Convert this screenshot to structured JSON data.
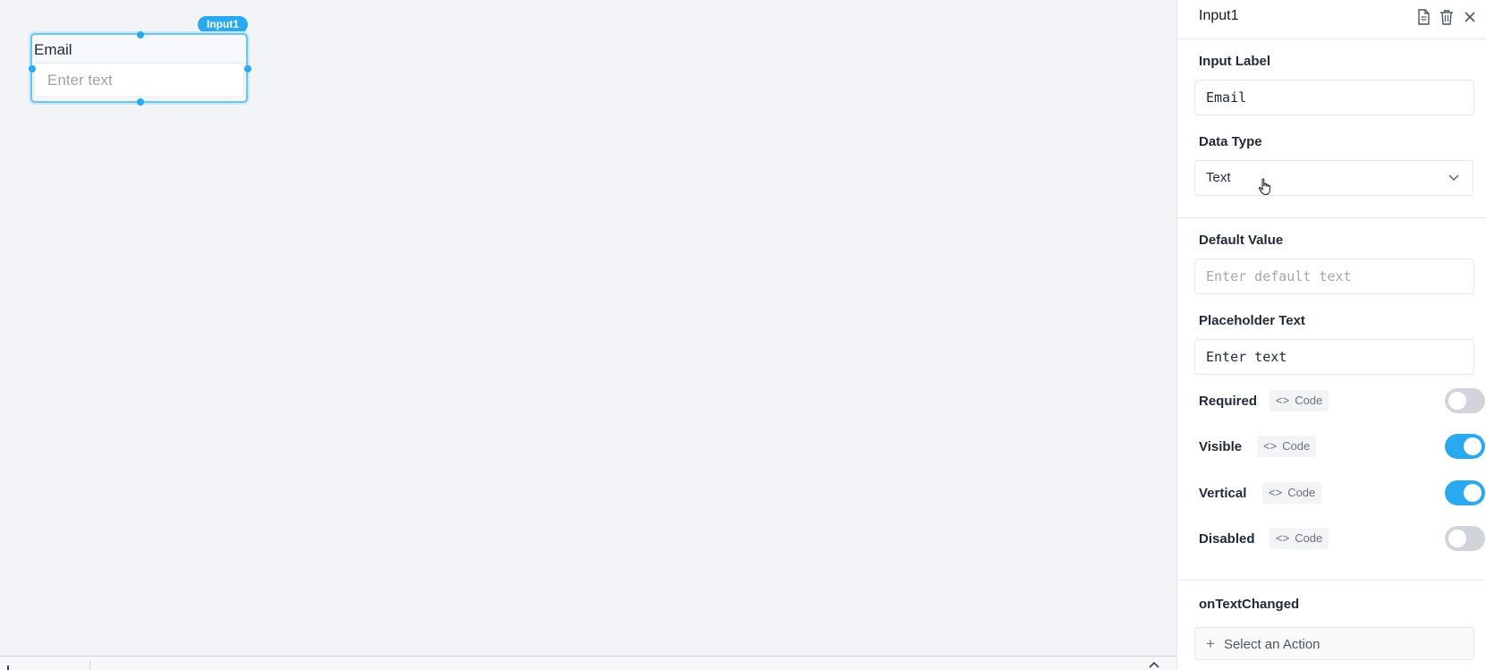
{
  "canvas": {
    "widget": {
      "badge": "Input1",
      "label": "Email",
      "placeholder": "Enter text"
    }
  },
  "panel": {
    "title": "Input1",
    "icons": [
      "document-icon",
      "trash-icon",
      "close-icon"
    ],
    "input_label": {
      "label": "Input Label",
      "value": "Email"
    },
    "data_type": {
      "label": "Data Type",
      "value": "Text"
    },
    "default_value": {
      "label": "Default Value",
      "placeholder": "Enter default text"
    },
    "placeholder_text": {
      "label": "Placeholder Text",
      "value": "Enter text"
    },
    "toggles": [
      {
        "label": "Required",
        "code": "Code",
        "on": false
      },
      {
        "label": "Visible",
        "code": "Code",
        "on": true
      },
      {
        "label": "Vertical",
        "code": "Code",
        "on": true
      },
      {
        "label": "Disabled",
        "code": "Code",
        "on": false
      }
    ],
    "on_text_changed": {
      "label": "onTextChanged",
      "action": "Select an Action"
    }
  },
  "colors": {
    "accent": "#29aaf0",
    "toggle_off": "#d1d5db"
  }
}
